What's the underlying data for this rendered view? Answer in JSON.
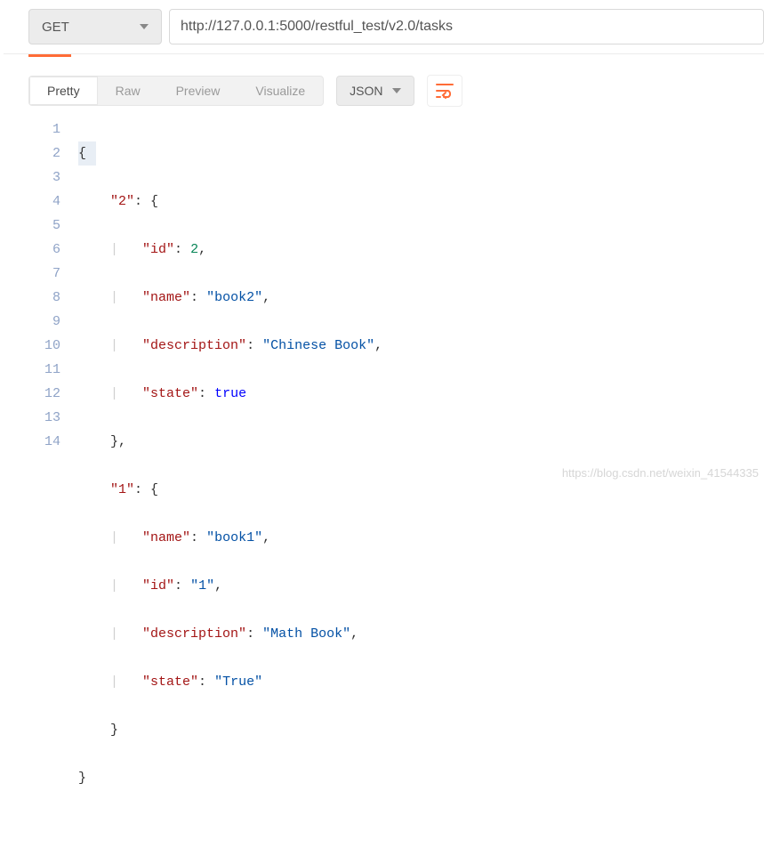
{
  "request": {
    "method": "GET",
    "url": "http://127.0.0.1:5000/restful_test/v2.0/tasks"
  },
  "view_tabs": {
    "pretty": "Pretty",
    "raw": "Raw",
    "preview": "Preview",
    "visualize": "Visualize"
  },
  "format_select": "JSON",
  "code_lines": {
    "l1": "{",
    "l2a": "\"2\"",
    "l2b": ": {",
    "l3a": "\"id\"",
    "l3b": ": ",
    "l3c": "2",
    "l3d": ",",
    "l4a": "\"name\"",
    "l4b": ": ",
    "l4c": "\"book2\"",
    "l4d": ",",
    "l5a": "\"description\"",
    "l5b": ": ",
    "l5c": "\"Chinese Book\"",
    "l5d": ",",
    "l6a": "\"state\"",
    "l6b": ": ",
    "l6c": "true",
    "l7": "},",
    "l8a": "\"1\"",
    "l8b": ": {",
    "l9a": "\"name\"",
    "l9b": ": ",
    "l9c": "\"book1\"",
    "l9d": ",",
    "l10a": "\"id\"",
    "l10b": ": ",
    "l10c": "\"1\"",
    "l10d": ",",
    "l11a": "\"description\"",
    "l11b": ": ",
    "l11c": "\"Math Book\"",
    "l11d": ",",
    "l12a": "\"state\"",
    "l12b": ": ",
    "l12c": "\"True\"",
    "l13": "}",
    "l14": "}"
  },
  "line_numbers": [
    "1",
    "2",
    "3",
    "4",
    "5",
    "6",
    "7",
    "8",
    "9",
    "10",
    "11",
    "12",
    "13",
    "14"
  ],
  "chart_data": {
    "type": "table",
    "title": "JSON response body",
    "data": {
      "2": {
        "id": 2,
        "name": "book2",
        "description": "Chinese Book",
        "state": true
      },
      "1": {
        "name": "book1",
        "id": "1",
        "description": "Math Book",
        "state": "True"
      }
    }
  },
  "watermark": "https://blog.csdn.net/weixin_41544335"
}
